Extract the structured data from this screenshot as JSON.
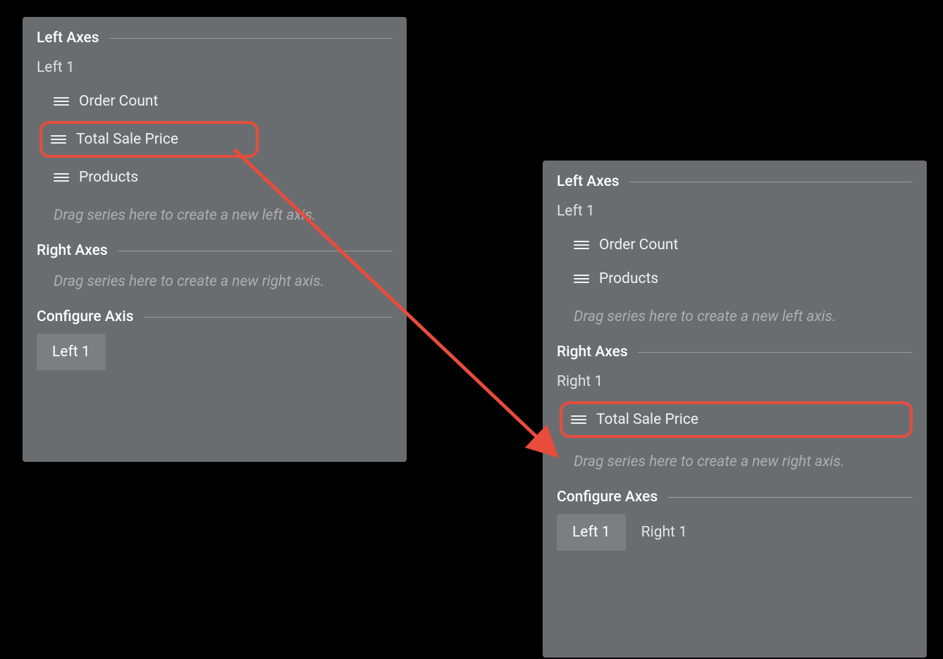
{
  "panelA": {
    "leftAxesHeader": "Left Axes",
    "axisName": "Left 1",
    "series": {
      "orderCount": "Order Count",
      "totalSalePrice": "Total Sale Price",
      "products": "Products"
    },
    "leftDropHint": "Drag series here to create a new left axis.",
    "rightAxesHeader": "Right Axes",
    "rightDropHint": "Drag series here to create a new right axis.",
    "configureHeader": "Configure Axis",
    "tabs": {
      "left1": "Left 1"
    }
  },
  "panelB": {
    "leftAxesHeader": "Left Axes",
    "leftAxisName": "Left 1",
    "leftSeries": {
      "orderCount": "Order Count",
      "products": "Products"
    },
    "leftDropHint": "Drag series here to create a new left axis.",
    "rightAxesHeader": "Right Axes",
    "rightAxisName": "Right 1",
    "rightSeries": {
      "totalSalePrice": "Total Sale Price"
    },
    "rightDropHint": "Drag series here to create a new right axis.",
    "configureHeader": "Configure Axes",
    "tabs": {
      "left1": "Left 1",
      "right1": "Right 1"
    }
  },
  "annotation": {
    "arrowColor": "#e74c3c"
  }
}
